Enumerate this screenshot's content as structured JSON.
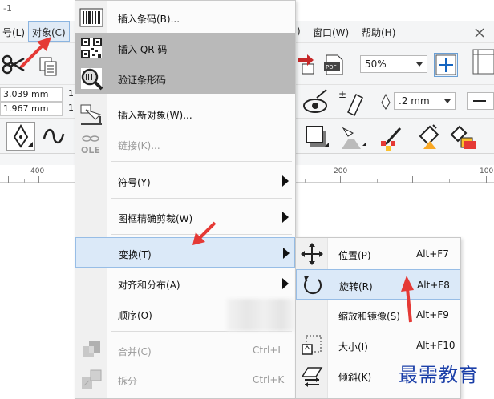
{
  "window": {
    "title_fragment": "-1"
  },
  "menubar": {
    "items": [
      {
        "label": "号(L)"
      },
      {
        "label": "对象(C)"
      },
      {
        "label": ")"
      },
      {
        "label": "窗口(W)"
      },
      {
        "label": "帮助(H)"
      }
    ]
  },
  "toolbar": {
    "zoom": "50%",
    "width_field": "3.039 mm",
    "height_field": "1.967 mm",
    "width_field_suffix": "1",
    "height_field_suffix": "1",
    "outline_width": ".2 mm"
  },
  "ruler": {
    "labels": [
      "400",
      "200",
      "100"
    ]
  },
  "object_menu": {
    "items": [
      {
        "label": "插入条码(B)...",
        "icon": "barcode-icon",
        "state": "normal"
      },
      {
        "label": "插入 QR 码",
        "icon": "qr-code-icon",
        "state": "highlighted"
      },
      {
        "label": "验证条形码",
        "icon": "barcode-magnifier-icon",
        "state": "highlighted"
      },
      {
        "label": "插入新对象(W)...",
        "icon": "insert-object-icon",
        "state": "normal"
      },
      {
        "label": "链接(K)...",
        "icon": "ole-link-icon",
        "state": "disabled"
      },
      {
        "label": "符号(Y)",
        "icon": "",
        "state": "submenu"
      },
      {
        "label": "图框精确剪裁(W)",
        "icon": "",
        "state": "submenu"
      },
      {
        "label": "变换(T)",
        "icon": "",
        "state": "submenu-open"
      },
      {
        "label": "对齐和分布(A)",
        "icon": "",
        "state": "submenu"
      },
      {
        "label": "顺序(O)",
        "icon": "",
        "state": "submenu"
      },
      {
        "label": "合并(C)",
        "shortcut": "Ctrl+L",
        "icon": "combine-icon",
        "state": "disabled"
      },
      {
        "label": "拆分",
        "shortcut": "Ctrl+K",
        "icon": "break-apart-icon",
        "state": "disabled"
      }
    ]
  },
  "transform_submenu": {
    "items": [
      {
        "label": "位置(P)",
        "shortcut": "Alt+F7",
        "icon": "move-arrows-icon"
      },
      {
        "label": "旋转(R)",
        "shortcut": "Alt+F8",
        "icon": "rotate-icon"
      },
      {
        "label": "缩放和镜像(S)",
        "shortcut": "Alt+F9",
        "icon": "scale-mirror-icon"
      },
      {
        "label": "大小(I)",
        "shortcut": "Alt+F10",
        "icon": "size-icon"
      },
      {
        "label": "倾斜(K)",
        "icon": "skew-icon"
      }
    ]
  },
  "watermark": {
    "text": "最需教育"
  },
  "colors": {
    "menu_highlight_gray": "#b9b9b9",
    "menu_highlight_blue": "#dbe9f8",
    "annotation_arrow": "#e53935",
    "watermark": "#1b3fa8"
  }
}
